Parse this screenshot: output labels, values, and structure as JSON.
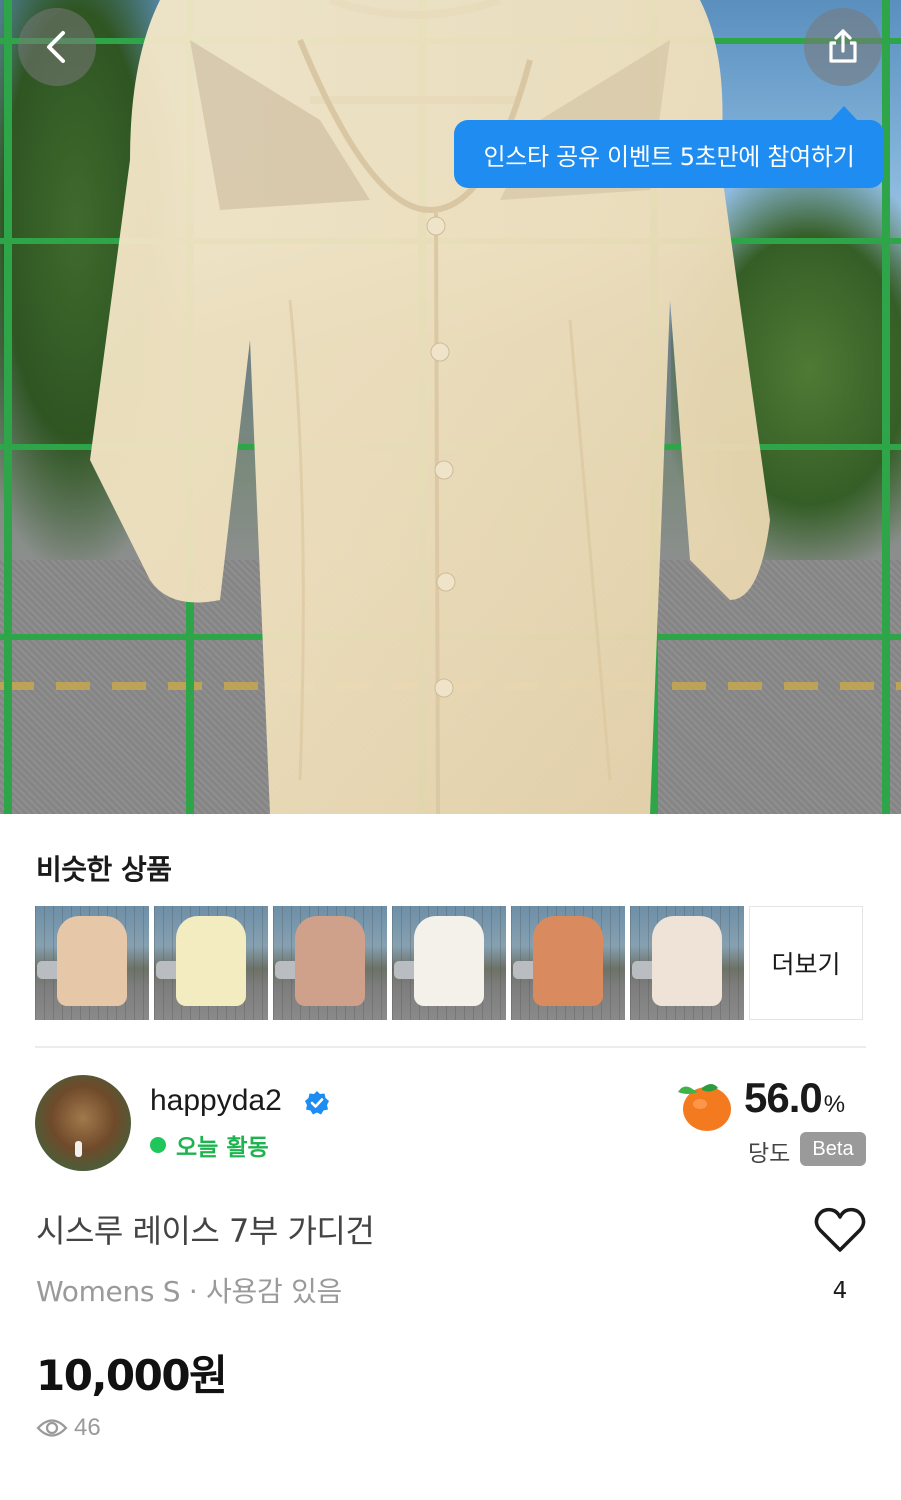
{
  "hero": {
    "tooltip_text": "인스타 공유 이벤트 5초만에 참여하기",
    "back_icon": "chevron-left-icon",
    "share_icon": "share-icon"
  },
  "similar": {
    "title": "비슷한 상품",
    "more_label": "더보기",
    "items": [
      {
        "color": "#e6c8a8"
      },
      {
        "color": "#f2ecc0"
      },
      {
        "color": "#cfa08a"
      },
      {
        "color": "#f4f1ea"
      },
      {
        "color": "#d98a5e"
      },
      {
        "color": "#eee3d6"
      }
    ]
  },
  "seller": {
    "username": "happyda2",
    "activity": "오늘 활동",
    "sweetness_value": "56.0",
    "sweetness_unit": "%",
    "sweetness_label": "당도",
    "beta_label": "Beta"
  },
  "product": {
    "title": "시스루 레이스 7부 가디건",
    "meta": "Womens S · 사용감 있음",
    "like_count": "4",
    "price": "10,000원",
    "views": "46"
  },
  "colors": {
    "accent_blue": "#1e8cf0",
    "active_green": "#1fb350",
    "fruit_orange": "#f47a20"
  }
}
